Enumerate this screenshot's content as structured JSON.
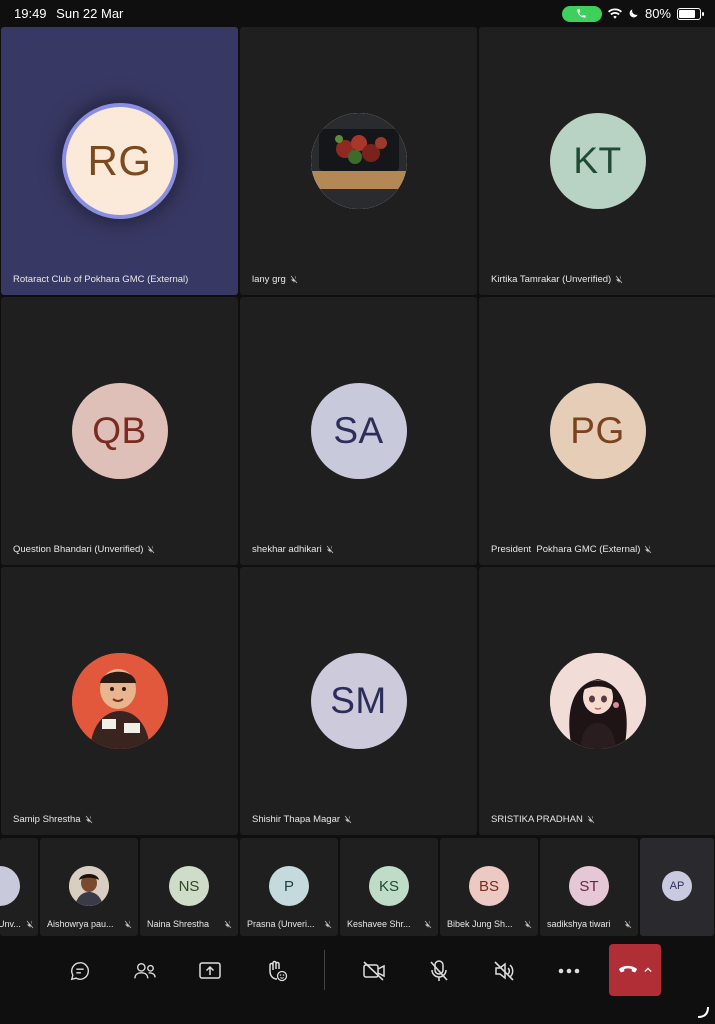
{
  "status_bar": {
    "time": "19:49",
    "date": "Sun 22 Mar",
    "battery": "80%",
    "battery_level": 0.8,
    "icons": [
      "phone-call-icon",
      "wifi-icon",
      "moon-icon",
      "battery-icon"
    ]
  },
  "participants": [
    {
      "name": "Rotaract Club of Pokhara GMC (External)",
      "initials": "RG",
      "avatar_type": "initials",
      "avatar_bg": "#fbe9d9",
      "avatar_fg": "#7c4a1f",
      "muted": false,
      "active_speaker": true
    },
    {
      "name": "lany grg",
      "initials": "",
      "avatar_type": "photo-food",
      "muted": true
    },
    {
      "name": "Kirtika Tamrakar (Unverified)",
      "initials": "KT",
      "avatar_type": "initials",
      "avatar_bg": "#b8d2c4",
      "avatar_fg": "#1f4a33",
      "muted": true
    },
    {
      "name": "Question Bhandari (Unverified)",
      "initials": "QB",
      "avatar_type": "initials",
      "avatar_bg": "#dfc0b8",
      "avatar_fg": "#7a2b1f",
      "muted": true
    },
    {
      "name": "shekhar adhikari",
      "initials": "SA",
      "avatar_type": "initials",
      "avatar_bg": "#c9c9dc",
      "avatar_fg": "#2d2d5a",
      "muted": true
    },
    {
      "name": "President  Pokhara GMC (External)",
      "initials": "PG",
      "avatar_type": "initials",
      "avatar_bg": "#e6cdb8",
      "avatar_fg": "#7a421f",
      "muted": true
    },
    {
      "name": "Samip Shrestha",
      "initials": "",
      "avatar_type": "photo-baby",
      "muted": true
    },
    {
      "name": "Shishir Thapa Magar",
      "initials": "SM",
      "avatar_type": "initials",
      "avatar_bg": "#cdcadb",
      "avatar_fg": "#2d2d5a",
      "muted": true
    },
    {
      "name": "SRISTIKA PRADHAN",
      "initials": "",
      "avatar_type": "photo-anime",
      "muted": true
    }
  ],
  "strip": [
    {
      "name": "Unv...",
      "initials": "",
      "avatar_bg": "#c9c9dc",
      "avatar_fg": "#2d2d5a",
      "muted": true,
      "partial": true
    },
    {
      "name": "Aishowrya pau...",
      "initials": "",
      "avatar_type": "photo-person",
      "muted": true
    },
    {
      "name": "Naina Shrestha",
      "initials": "NS",
      "avatar_bg": "#cfdcc8",
      "avatar_fg": "#2f4a24",
      "muted": true
    },
    {
      "name": "Prasna (Unveri...",
      "initials": "P",
      "avatar_bg": "#c4dadd",
      "avatar_fg": "#1f4048",
      "muted": true
    },
    {
      "name": "Keshavee Shr...",
      "initials": "KS",
      "avatar_bg": "#bfdcc8",
      "avatar_fg": "#1f4a2f",
      "muted": true
    },
    {
      "name": "Bibek Jung Sh...",
      "initials": "BS",
      "avatar_bg": "#ecc9c2",
      "avatar_fg": "#7a2b1f",
      "muted": true
    },
    {
      "name": "sadikshya tiwari",
      "initials": "ST",
      "avatar_bg": "#e6c7d6",
      "avatar_fg": "#6a2449",
      "muted": true
    },
    {
      "name": "",
      "initials": "AP",
      "avatar_bg": "#c9c9e0",
      "avatar_fg": "#2d2d5a",
      "muted": false,
      "more": true
    }
  ],
  "toolbar": {
    "buttons": [
      "chat-icon",
      "people-icon",
      "share-screen-icon",
      "raise-hand-icon",
      "camera-off-icon",
      "mic-off-icon",
      "speaker-off-icon",
      "more-icon"
    ],
    "leave_color": "#b02e35"
  }
}
